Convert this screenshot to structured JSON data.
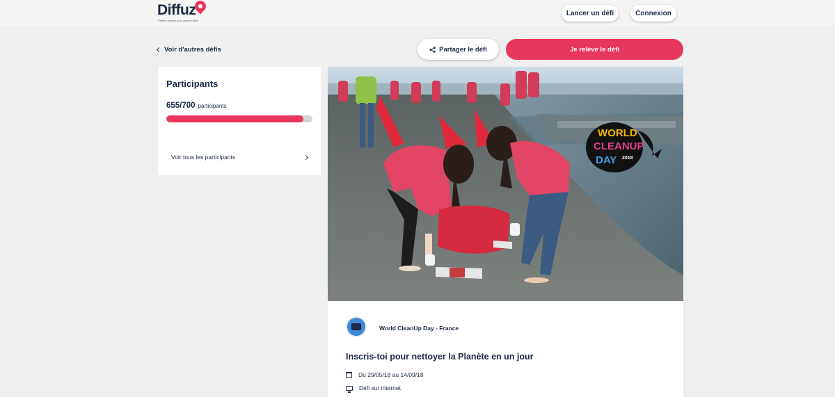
{
  "app": {
    "logo_text": "Diffuz",
    "logo_tagline": "Petites actions pour grands défis"
  },
  "header": {
    "launch_label": "Lancer un défi",
    "login_label": "Connexion"
  },
  "actions": {
    "back_label": "Voir d'autres défis",
    "share_label": "Partager le défi",
    "cta_label": "Je relève le défi"
  },
  "participants": {
    "title": "Participants",
    "count_text": "655/700",
    "unit": "participants",
    "current": 655,
    "max": 700,
    "see_all_label": "Voir tous les participants"
  },
  "hero": {
    "badge_line1": "WORLD",
    "badge_line2": "CLEANUP",
    "badge_line3": "DAY",
    "badge_year": "2018"
  },
  "challenge": {
    "organizer": "World CleanUp Day - France",
    "title": "Inscris-toi pour nettoyer la Planète en un jour",
    "dates": "Du 29/05/18 au 14/09/18",
    "mode": "Défi sur internet"
  },
  "colors": {
    "accent": "#e8365c",
    "text": "#1c2a44",
    "background": "#efefef"
  }
}
